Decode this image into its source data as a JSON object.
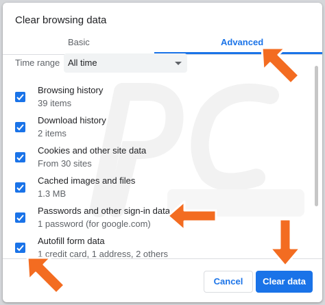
{
  "dialog": {
    "title": "Clear browsing data",
    "tabs": [
      {
        "label": "Basic",
        "active": false
      },
      {
        "label": "Advanced",
        "active": true
      }
    ]
  },
  "time_range": {
    "label": "Time range",
    "value": "All time"
  },
  "items": [
    {
      "label": "Browsing history",
      "detail": "39 items",
      "checked": true
    },
    {
      "label": "Download history",
      "detail": "2 items",
      "checked": true
    },
    {
      "label": "Cookies and other site data",
      "detail": "From 30 sites",
      "checked": true
    },
    {
      "label": "Cached images and files",
      "detail": "1.3 MB",
      "checked": true
    },
    {
      "label": "Passwords and other sign-in data",
      "detail": "1 password (for google.com)",
      "checked": true
    },
    {
      "label": "Autofill form data",
      "detail": "1 credit card, 1 address, 2 others",
      "checked": true
    }
  ],
  "footer": {
    "cancel_label": "Cancel",
    "clear_label": "Clear data"
  },
  "colors": {
    "accent": "#1a73e8",
    "annotation_arrow": "#f36c21"
  }
}
